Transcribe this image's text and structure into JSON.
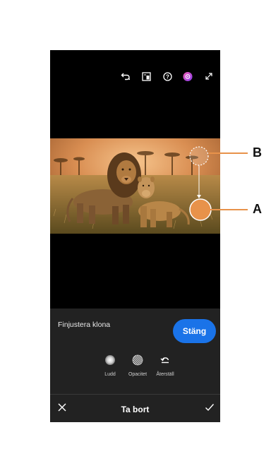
{
  "panel": {
    "title": "Finjustera klona",
    "close_label": "Stäng"
  },
  "tools": [
    {
      "label": "Ludd",
      "icon": "feather-circle-icon"
    },
    {
      "label": "Opacitet",
      "icon": "opacity-circle-icon"
    },
    {
      "label": "Återställ",
      "icon": "reset-icon"
    }
  ],
  "bottom_bar": {
    "title": "Ta bort",
    "cancel_icon": "close-icon",
    "confirm_icon": "checkmark-icon"
  },
  "topbar_icons": [
    "undo-icon",
    "compare-icon",
    "help-icon",
    "profile-icon",
    "expand-icon"
  ],
  "callouts": {
    "b_label": "B",
    "a_label": "A"
  },
  "colors": {
    "accent": "#1a73e8",
    "callout_orange": "#e8924a"
  }
}
